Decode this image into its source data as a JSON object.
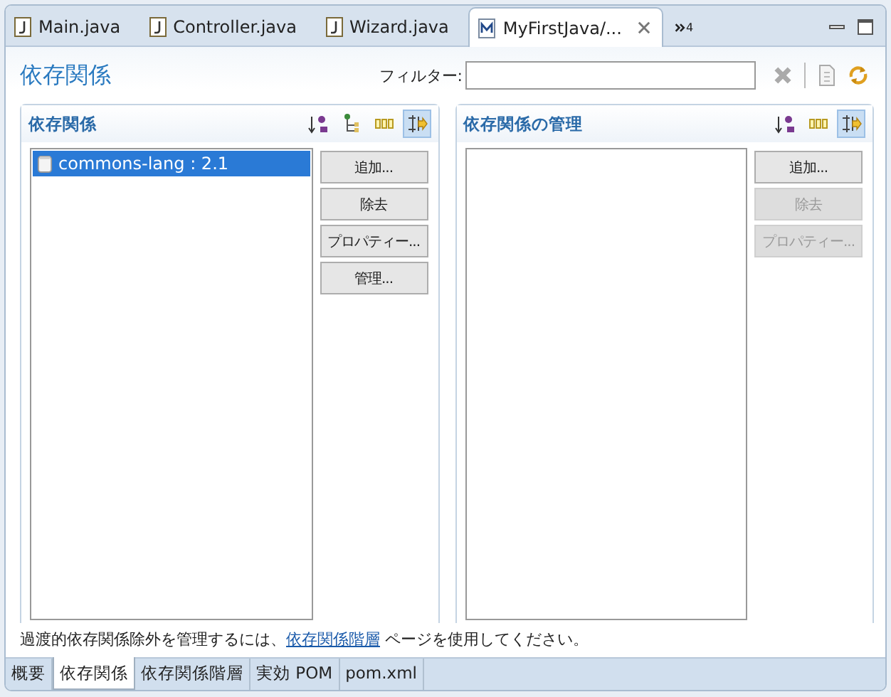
{
  "editor_tabs": [
    {
      "label": "Main.java",
      "kind": "java",
      "selected": false,
      "closable": false
    },
    {
      "label": "Controller.java",
      "kind": "java",
      "selected": false,
      "closable": false
    },
    {
      "label": "Wizard.java",
      "kind": "java",
      "selected": false,
      "closable": false
    },
    {
      "label": "MyFirstJava/...",
      "kind": "maven",
      "selected": true,
      "closable": true
    }
  ],
  "overflow_count": "4",
  "page": {
    "title": "依存関係",
    "filter_label": "フィルター:"
  },
  "sections": [
    {
      "title": "依存関係",
      "tools": [
        {
          "kind": "sort",
          "selected": false
        },
        {
          "kind": "tree",
          "selected": false
        },
        {
          "kind": "columns",
          "selected": false
        },
        {
          "kind": "filter",
          "selected": true
        }
      ],
      "items": [
        {
          "label": "commons-lang : 2.1",
          "selected": true
        }
      ],
      "buttons": [
        {
          "label": "追加...",
          "disabled": false
        },
        {
          "label": "除去",
          "disabled": false
        },
        {
          "label": "プロパティー...",
          "disabled": false
        },
        {
          "label": "管理...",
          "disabled": false
        }
      ]
    },
    {
      "title": "依存関係の管理",
      "tools": [
        {
          "kind": "sort",
          "selected": false
        },
        {
          "kind": "columns",
          "selected": false
        },
        {
          "kind": "filter",
          "selected": true
        }
      ],
      "buttons": [
        {
          "label": "追加...",
          "disabled": false
        },
        {
          "label": "除去",
          "disabled": true
        },
        {
          "label": "プロパティー...",
          "disabled": true
        }
      ]
    }
  ],
  "note": {
    "before": "過渡的依存関係除外を管理するには、",
    "link": "依存関係階層",
    "after": " ページを使用してください。"
  },
  "page_tabs": [
    {
      "label": "概要",
      "selected": false
    },
    {
      "label": "依存関係",
      "selected": true
    },
    {
      "label": "依存関係階層",
      "selected": false
    },
    {
      "label": "実効 POM",
      "selected": false
    },
    {
      "label": "pom.xml",
      "selected": false
    }
  ]
}
